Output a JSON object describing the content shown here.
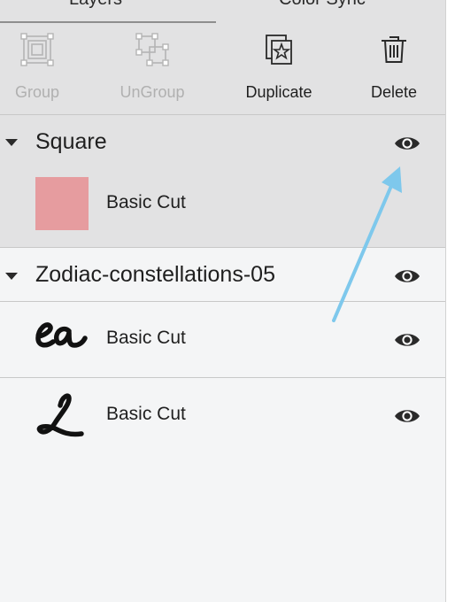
{
  "tabs": {
    "layers": "Layers",
    "color_sync": "Color Sync"
  },
  "toolbar": {
    "group": "Group",
    "ungroup": "UnGroup",
    "duplicate": "Duplicate",
    "delete": "Delete"
  },
  "groups": [
    {
      "name": "Square",
      "items": [
        {
          "label": "Basic Cut",
          "swatch_color": "#e69c9f"
        }
      ]
    },
    {
      "name": "Zodiac-constellations-05",
      "items": [
        {
          "label": "Basic Cut",
          "thumb": "eq-script-glyph"
        },
        {
          "label": "Basic Cut",
          "thumb": "L-script-glyph"
        }
      ]
    }
  ],
  "colors": {
    "arrow": "#7ec8ec",
    "panel_bg": "#f4f5f6",
    "header_bg": "#e2e2e3"
  }
}
